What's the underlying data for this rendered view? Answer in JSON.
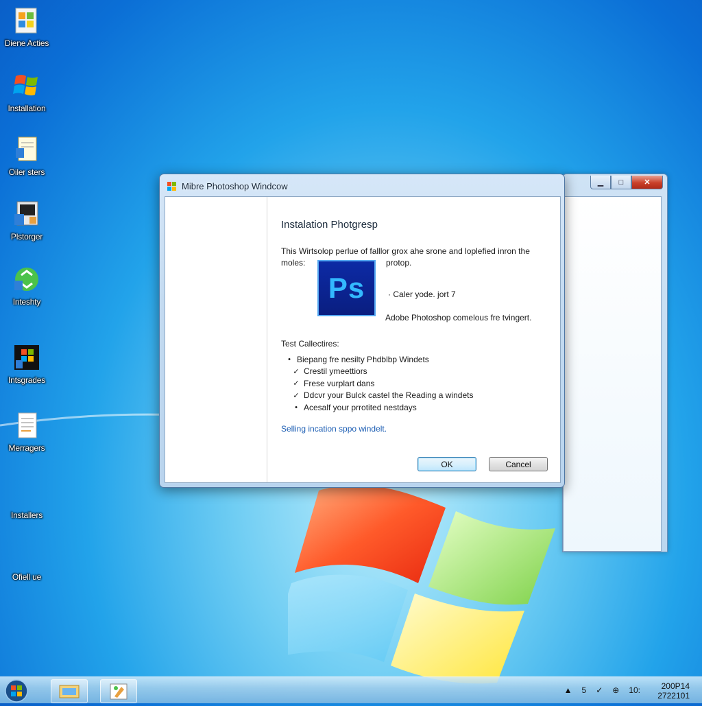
{
  "desktop": {
    "icons": [
      {
        "label": "Diene Acties",
        "icon": "folder-icon"
      },
      {
        "label": "Installation",
        "icon": "windows-flag-icon"
      },
      {
        "label": "Oiler sters",
        "icon": "document-icon"
      },
      {
        "label": "Plstorger",
        "icon": "pictures-icon"
      },
      {
        "label": "Inteshty",
        "icon": "recycle-icon"
      },
      {
        "label": "Intsgrades",
        "icon": "media-center-icon"
      },
      {
        "label": "Merragers",
        "icon": "text-file-icon"
      },
      {
        "label": "Installers",
        "icon": ""
      },
      {
        "label": "Ofiell ue",
        "icon": ""
      }
    ]
  },
  "dialog": {
    "title": "Mibre Photoshop Windcow",
    "heading": "Instalation Photgresp",
    "intro_line1": "This Wirtsolop perlue of falllor grox ahe srone and loplefied inron the",
    "intro_line2": "moles:",
    "note1": "protop.",
    "note2": "· Caler yode. jort 7",
    "note3": "Adobe Photoshop comelous fre tvingert.",
    "logo_text": "Ps",
    "section_title": "Test Callectires:",
    "tasks": [
      {
        "marker": "•",
        "text": "Biepang fre nesilty Phdblbp Windets"
      },
      {
        "marker": "✓",
        "text": "Crestil ymeettiors"
      },
      {
        "marker": "✓",
        "text": "Frese vurplart dans"
      },
      {
        "marker": "✓",
        "text": "Ddcvr your Bulck castel the Reading a windets"
      },
      {
        "marker": "•",
        "text": "Acesalf your prrotited nestdays"
      }
    ],
    "link": "Selling incation sppo windelt.",
    "ok_label": "OK",
    "cancel_label": "Cancel"
  },
  "background_window": {
    "caption_buttons": [
      "minimize",
      "maximize",
      "close"
    ]
  },
  "taskbar": {
    "tray_items": [
      "▲",
      "5",
      "✓",
      "⊕",
      "10:"
    ],
    "clock_line1": "200P14",
    "clock_line2": "2722101"
  },
  "colors": {
    "desktop_blue": "#1c8fe3",
    "link_blue": "#1e5fb4",
    "ps_blue": "#0c2aa5",
    "ps_text": "#33b9ff"
  }
}
